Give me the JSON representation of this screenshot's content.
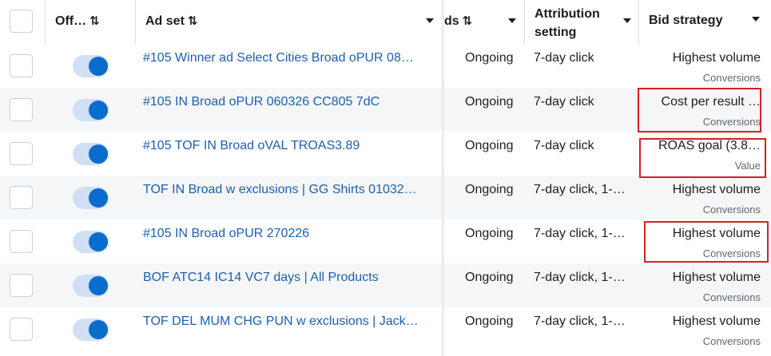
{
  "header": {
    "off_on": "Off…",
    "ad_set": "Ad set",
    "results_partial": "ds",
    "attribution": "Attribution setting",
    "attribution_line1": "Attribution",
    "attribution_line2": "setting",
    "bid_strategy": "Bid strategy",
    "sort_glyph": "⇅"
  },
  "rows": [
    {
      "name": "#105 Winner ad Select Cities Broad oPUR 08…",
      "status": "Ongoing",
      "attribution": "7-day click",
      "bid": "Highest volume",
      "bid_sub": "Conversions",
      "on": true
    },
    {
      "name": "#105 IN Broad oPUR 060326 CC805 7dC",
      "status": "Ongoing",
      "attribution": "7-day click",
      "bid": "Cost per result …",
      "bid_sub": "Conversions",
      "on": true
    },
    {
      "name": "#105 TOF IN Broad oVAL TROAS3.89",
      "status": "Ongoing",
      "attribution": "7-day click",
      "bid": "ROAS goal (3.8…",
      "bid_sub": "Value",
      "on": true
    },
    {
      "name": "TOF IN Broad w exclusions | GG Shirts 01032…",
      "status": "Ongoing",
      "attribution": "7-day click, 1-…",
      "bid": "Highest volume",
      "bid_sub": "Conversions",
      "on": true
    },
    {
      "name": "#105 IN Broad oPUR 270226",
      "status": "Ongoing",
      "attribution": "7-day click, 1-…",
      "bid": "Highest volume",
      "bid_sub": "Conversions",
      "on": true
    },
    {
      "name": "BOF ATC14 IC14 VC7 days | All Products",
      "status": "Ongoing",
      "attribution": "7-day click, 1-…",
      "bid": "Highest volume",
      "bid_sub": "Conversions",
      "on": true
    },
    {
      "name": "TOF DEL MUM CHG PUN w exclusions | Jack…",
      "status": "Ongoing",
      "attribution": "7-day click, 1-…",
      "bid": "Highest volume",
      "bid_sub": "Conversions",
      "on": true
    }
  ],
  "colors": {
    "link": "#1d5fae",
    "toggle_on": "#0a6ccc",
    "highlight": "#d4202a"
  }
}
